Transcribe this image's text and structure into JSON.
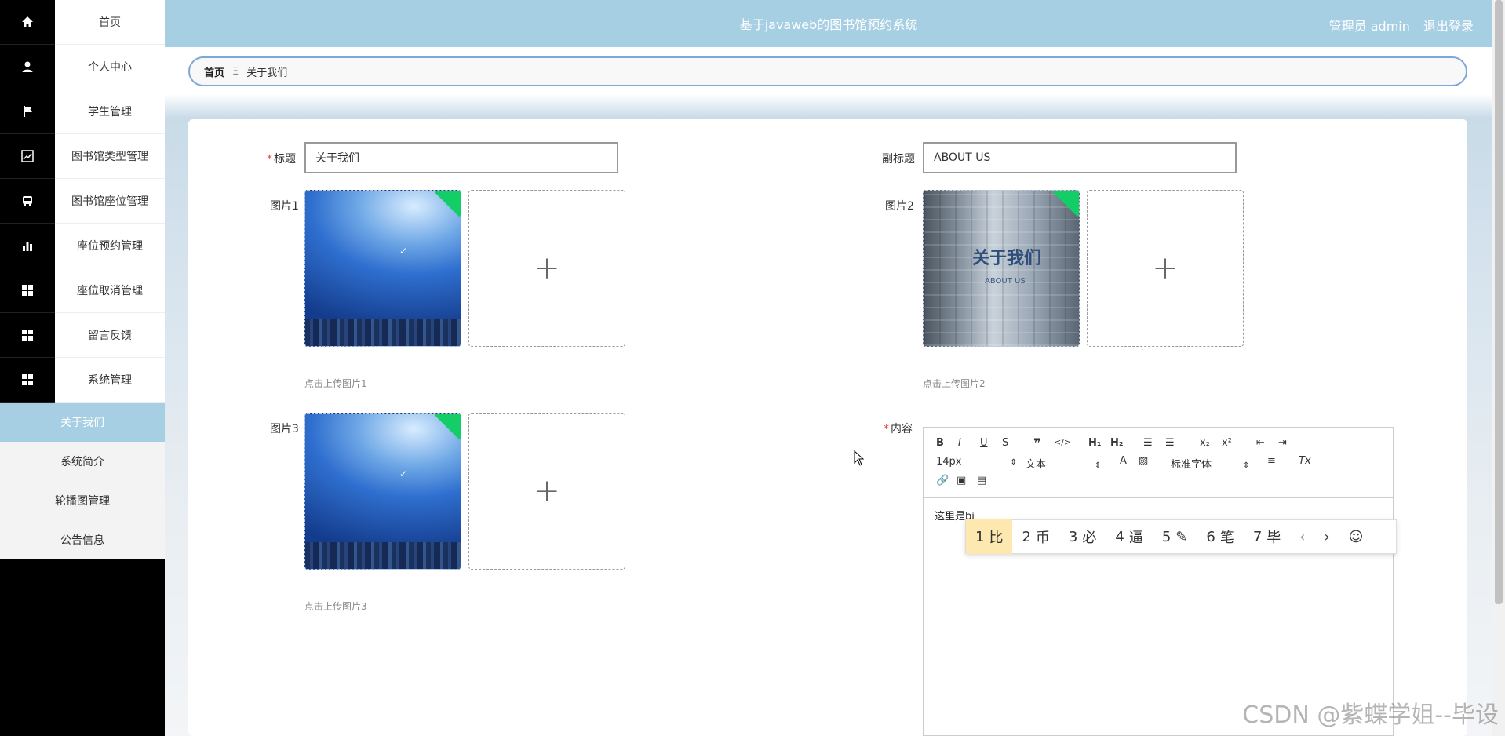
{
  "header": {
    "title": "基于javaweb的图书馆预约系统",
    "user": "管理员 admin",
    "logout": "退出登录"
  },
  "sidebar": {
    "items": [
      {
        "label": "首页",
        "icon": "home-icon"
      },
      {
        "label": "个人中心",
        "icon": "user-icon"
      },
      {
        "label": "学生管理",
        "icon": "flag-icon"
      },
      {
        "label": "图书馆类型管理",
        "icon": "chart-icon"
      },
      {
        "label": "图书馆座位管理",
        "icon": "bus-icon"
      },
      {
        "label": "座位预约管理",
        "icon": "bar-chart-icon"
      },
      {
        "label": "座位取消管理",
        "icon": "grid-icon"
      },
      {
        "label": "留言反馈",
        "icon": "grid-icon"
      },
      {
        "label": "系统管理",
        "icon": "grid-icon"
      }
    ],
    "sub_items": [
      {
        "label": "关于我们",
        "active": true
      },
      {
        "label": "系统简介",
        "active": false
      },
      {
        "label": "轮播图管理",
        "active": false
      },
      {
        "label": "公告信息",
        "active": false
      }
    ]
  },
  "breadcrumb": {
    "home": "首页",
    "separator": "Ξ",
    "current": "关于我们"
  },
  "form": {
    "title_label": "标题",
    "title_value": "关于我们",
    "subtitle_label": "副标题",
    "subtitle_value": "ABOUT US",
    "pic1_label": "图片1",
    "pic1_hint": "点击上传图片1",
    "pic2_label": "图片2",
    "pic2_hint": "点击上传图片2",
    "pic3_label": "图片3",
    "pic3_hint": "点击上传图片3",
    "content_label": "内容",
    "required_mark": "*",
    "pic2_caption": "关于我们",
    "pic2_caption_en": "ABOUT US"
  },
  "editor": {
    "font_size": "14px",
    "text_type": "文本",
    "font_family": "标准字体",
    "content": "这里是bi"
  },
  "ime": {
    "candidates": [
      {
        "n": "1",
        "c": "比"
      },
      {
        "n": "2",
        "c": "币"
      },
      {
        "n": "3",
        "c": "必"
      },
      {
        "n": "4",
        "c": "逼"
      },
      {
        "n": "5",
        "c": "✎"
      },
      {
        "n": "6",
        "c": "笔"
      },
      {
        "n": "7",
        "c": "毕"
      }
    ]
  },
  "watermark": "CSDN @紫蝶学姐--毕设"
}
